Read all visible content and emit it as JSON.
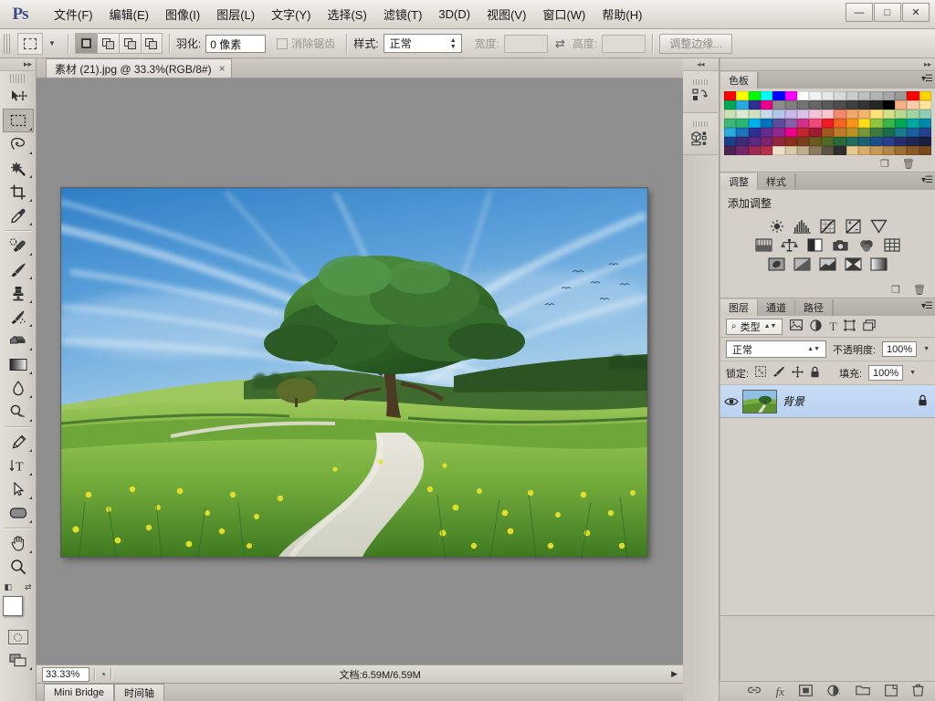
{
  "app": {
    "logo": "Ps",
    "title": "Adobe Photoshop"
  },
  "window_controls": {
    "minimize": "—",
    "maximize": "□",
    "close": "✕"
  },
  "menu": [
    {
      "label": "文件(F)",
      "name": "menu-file"
    },
    {
      "label": "编辑(E)",
      "name": "menu-edit"
    },
    {
      "label": "图像(I)",
      "name": "menu-image"
    },
    {
      "label": "图层(L)",
      "name": "menu-layer"
    },
    {
      "label": "文字(Y)",
      "name": "menu-type"
    },
    {
      "label": "选择(S)",
      "name": "menu-select"
    },
    {
      "label": "滤镜(T)",
      "name": "menu-filter"
    },
    {
      "label": "3D(D)",
      "name": "menu-3d"
    },
    {
      "label": "视图(V)",
      "name": "menu-view"
    },
    {
      "label": "窗口(W)",
      "name": "menu-window"
    },
    {
      "label": "帮助(H)",
      "name": "menu-help"
    }
  ],
  "options_bar": {
    "feather_label": "羽化:",
    "feather_value": "0 像素",
    "antialias_label": "消除锯齿",
    "style_label": "样式:",
    "style_value": "正常",
    "width_label": "宽度:",
    "width_value": "",
    "height_label": "高度:",
    "height_value": "",
    "refine_edge": "调整边缘..."
  },
  "document_tab": {
    "title": "素材 (21).jpg @ 33.3%(RGB/8#)",
    "close": "×"
  },
  "status_bar": {
    "zoom": "33.33%",
    "doc_info": "文档:6.59M/6.59M",
    "arrow": "▶"
  },
  "bottom_tabs": [
    {
      "label": "Mini Bridge",
      "name": "tab-mini-bridge",
      "selected": true
    },
    {
      "label": "时间轴",
      "name": "tab-timeline",
      "selected": false
    }
  ],
  "toolbox": {
    "collapse": "▸▸",
    "tools": [
      {
        "name": "move-tool",
        "label": "移动工具",
        "active": false
      },
      {
        "name": "rectangular-marquee-tool",
        "label": "矩形选框工具",
        "active": true
      },
      {
        "name": "lasso-tool",
        "label": "套索工具",
        "active": false
      },
      {
        "name": "quick-selection-tool",
        "label": "快速选择工具",
        "active": false
      },
      {
        "name": "crop-tool",
        "label": "裁剪工具",
        "active": false
      },
      {
        "name": "eyedropper-tool",
        "label": "吸管工具",
        "active": false
      },
      {
        "name": "spot-healing-brush-tool",
        "label": "污点修复画笔工具",
        "active": false
      },
      {
        "name": "brush-tool",
        "label": "画笔工具",
        "active": false
      },
      {
        "name": "clone-stamp-tool",
        "label": "仿制图章工具",
        "active": false
      },
      {
        "name": "history-brush-tool",
        "label": "历史记录画笔工具",
        "active": false
      },
      {
        "name": "eraser-tool",
        "label": "橡皮擦工具",
        "active": false
      },
      {
        "name": "gradient-tool",
        "label": "渐变工具",
        "active": false
      },
      {
        "name": "blur-tool",
        "label": "模糊工具",
        "active": false
      },
      {
        "name": "dodge-tool",
        "label": "减淡工具",
        "active": false
      },
      {
        "name": "pen-tool",
        "label": "钢笔工具",
        "active": false
      },
      {
        "name": "horizontal-type-tool",
        "label": "横排文字工具",
        "active": false
      },
      {
        "name": "path-selection-tool",
        "label": "路径选择工具",
        "active": false
      },
      {
        "name": "rounded-rectangle-tool",
        "label": "圆角矩形工具",
        "active": false
      },
      {
        "name": "hand-tool",
        "label": "抓手工具",
        "active": false
      },
      {
        "name": "zoom-tool",
        "label": "缩放工具",
        "active": false
      }
    ],
    "foreground_color": "#ffffff",
    "background_color": "#000000",
    "quick_mask_label": "以快速蒙版模式编辑",
    "screen_mode_label": "更改屏幕模式"
  },
  "dock_rail": [
    {
      "name": "history-panel-icon",
      "label": "历史记录"
    },
    {
      "name": "3d-panel-icon",
      "label": "3D"
    }
  ],
  "swatches_panel": {
    "tab": "色板",
    "menu": "▾☰",
    "colors": [
      "#ff0000",
      "#ffff00",
      "#00ff00",
      "#00ffff",
      "#0000ff",
      "#ff00ff",
      "#ffffff",
      "#f2f2f2",
      "#e6e6e6",
      "#d9d9d9",
      "#cccccc",
      "#bfbfbf",
      "#b3b3b3",
      "#a6a6a6",
      "#999999",
      "#ff0000",
      "#ffd400",
      "#00a651",
      "#29abe2",
      "#2e3192",
      "#ec008c",
      "#8c8c8c",
      "#808080",
      "#737373",
      "#666666",
      "#595959",
      "#4d4d4d",
      "#404040",
      "#333333",
      "#262626",
      "#000000",
      "#f4b183",
      "#f8cbad",
      "#ffe699",
      "#c9e2b3",
      "#d9ead3",
      "#cfe2c0",
      "#c5dbe8",
      "#b4c7e7",
      "#c9b8e8",
      "#d9c2e9",
      "#f4c2d7",
      "#f7c6ce",
      "#f4886a",
      "#f0a868",
      "#f3b56b",
      "#ffe27a",
      "#d6e08a",
      "#b7d98c",
      "#9fd4a1",
      "#8fcfb8",
      "#3cb878",
      "#2bb673",
      "#00aeef",
      "#0072bc",
      "#5c4b99",
      "#8560a8",
      "#d4308e",
      "#ef4a7b",
      "#ed1c24",
      "#f26522",
      "#f7941e",
      "#ffde17",
      "#8dc63f",
      "#39b54a",
      "#00a651",
      "#00a99d",
      "#0088a8",
      "#2ba9e0",
      "#1c75bc",
      "#2e3192",
      "#662d91",
      "#92278f",
      "#ec008c",
      "#c1272d",
      "#9e1b32",
      "#a3561f",
      "#c07c26",
      "#b89427",
      "#77973a",
      "#3e7a3e",
      "#1b6b4a",
      "#1a7a8c",
      "#1c5f9e",
      "#25408f",
      "#1b3f8b",
      "#3d2b7a",
      "#5b2a83",
      "#7b2371",
      "#93263f",
      "#8c2f1d",
      "#7a3f1d",
      "#6b5a1d",
      "#4f6b24",
      "#2b6b3a",
      "#236b5c",
      "#1a5f72",
      "#1b4f8a",
      "#2a3f8c",
      "#262f6e",
      "#1f2752",
      "#1a1f3d",
      "#4d2352",
      "#74276a",
      "#9c2a52",
      "#b4304a",
      "#f0dfc8",
      "#d8c8a8",
      "#bfae8d",
      "#8c7a5e",
      "#5e5445",
      "#2f2f2f",
      "#e8c98f",
      "#d9ad6a",
      "#c49a55",
      "#b08545",
      "#9c6f35",
      "#8a5a27",
      "#7a4a1f"
    ]
  },
  "adjustments_panel": {
    "tabs": [
      {
        "label": "调整",
        "name": "tab-adjustments",
        "selected": true
      },
      {
        "label": "样式",
        "name": "tab-styles",
        "selected": false
      }
    ],
    "menu": "▾☰",
    "title": "添加调整",
    "buttons": [
      {
        "name": "brightness-contrast-icon",
        "label": "亮度/对比度"
      },
      {
        "name": "levels-icon",
        "label": "色阶"
      },
      {
        "name": "curves-icon",
        "label": "曲线"
      },
      {
        "name": "exposure-icon",
        "label": "曝光度"
      },
      {
        "name": "vibrance-icon",
        "label": "自然饱和度"
      },
      {
        "name": "hue-saturation-icon",
        "label": "色相/饱和度"
      },
      {
        "name": "color-balance-icon",
        "label": "色彩平衡"
      },
      {
        "name": "black-white-icon",
        "label": "黑白"
      },
      {
        "name": "photo-filter-icon",
        "label": "照片滤镜"
      },
      {
        "name": "channel-mixer-icon",
        "label": "通道混合器"
      },
      {
        "name": "color-lookup-icon",
        "label": "颜色查找"
      },
      {
        "name": "invert-icon",
        "label": "反相"
      },
      {
        "name": "posterize-icon",
        "label": "色调分离"
      },
      {
        "name": "threshold-icon",
        "label": "阈值"
      },
      {
        "name": "gradient-map-icon",
        "label": "渐变映射"
      },
      {
        "name": "selective-color-icon",
        "label": "可选颜色"
      }
    ],
    "footer_icons": [
      {
        "name": "new-adjustment-icon",
        "label": "新建"
      },
      {
        "name": "delete-adjustment-icon",
        "label": "删除"
      }
    ]
  },
  "layers_panel": {
    "tabs": [
      {
        "label": "图层",
        "name": "tab-layers",
        "selected": true
      },
      {
        "label": "通道",
        "name": "tab-channels",
        "selected": false
      },
      {
        "label": "路径",
        "name": "tab-paths",
        "selected": false
      }
    ],
    "menu": "▾☰",
    "filter": {
      "kind_label": "类型",
      "icons": [
        {
          "name": "filter-pixel-icon",
          "label": "像素图层"
        },
        {
          "name": "filter-adjustment-icon",
          "label": "调整图层"
        },
        {
          "name": "filter-type-icon",
          "label": "文字图层"
        },
        {
          "name": "filter-shape-icon",
          "label": "形状图层"
        },
        {
          "name": "filter-smart-object-icon",
          "label": "智能对象"
        }
      ]
    },
    "blend_mode": "正常",
    "opacity_label": "不透明度:",
    "opacity_value": "100%",
    "lock_label": "锁定:",
    "lock_icons": [
      {
        "name": "lock-transparent-pixels-icon",
        "label": "锁定透明像素"
      },
      {
        "name": "lock-image-pixels-icon",
        "label": "锁定图像像素"
      },
      {
        "name": "lock-position-icon",
        "label": "锁定位置"
      },
      {
        "name": "lock-all-icon",
        "label": "锁定全部"
      }
    ],
    "fill_label": "填充:",
    "fill_value": "100%",
    "layers": [
      {
        "name": "背景",
        "visible": true,
        "locked": true,
        "selected": true
      }
    ],
    "footer_icons": [
      {
        "name": "link-layers-icon",
        "label": "链接图层"
      },
      {
        "name": "layer-style-icon",
        "label": "添加图层样式"
      },
      {
        "name": "layer-mask-icon",
        "label": "添加图层蒙版"
      },
      {
        "name": "new-fill-adjustment-icon",
        "label": "创建新的填充或调整图层"
      },
      {
        "name": "new-group-icon",
        "label": "创建新组"
      },
      {
        "name": "new-layer-icon",
        "label": "创建新图层"
      },
      {
        "name": "delete-layer-icon",
        "label": "删除图层"
      }
    ]
  },
  "canvas": {
    "image_description": "绿色草地与大树，蜿蜒小路，蓝天白云",
    "zoom_percent": "33.33%"
  },
  "colors": {
    "accent": "#b9d2f0",
    "panel_bg": "#d4d0c9",
    "canvas_bg": "#8f8f8f",
    "chrome": "#d6d2cb"
  }
}
